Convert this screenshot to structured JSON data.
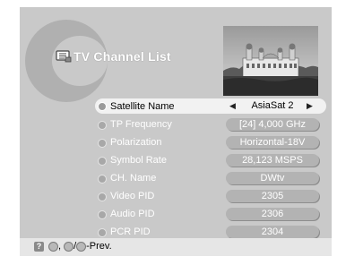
{
  "title": "TV Channel List",
  "icons": {
    "title_icon": "tv-list-icon",
    "help_icon": "question-icon",
    "footer_buttons": [
      "info-button-icon",
      "menu-button-icon",
      "exit-button-icon"
    ]
  },
  "colors": {
    "panel": "#c9c9c9",
    "big_letter": "#b0b0b0",
    "selected_row": "#f2f2f2",
    "value_pill": "#b3b3b3",
    "footer": "#e6e6e6"
  },
  "rows": [
    {
      "label": "Satellite Name",
      "value": "AsiaSat 2",
      "selected": true
    },
    {
      "label": "TP Frequency",
      "value": "[24]  4,000 GHz"
    },
    {
      "label": "Polarization",
      "value": "Horizontal-18V"
    },
    {
      "label": "Symbol Rate",
      "value": "28,123 MSPS"
    },
    {
      "label": "CH. Name",
      "value": "DWtv"
    },
    {
      "label": "Video PID",
      "value": "2305"
    },
    {
      "label": "Audio PID",
      "value": "2306"
    },
    {
      "label": "PCR PID",
      "value": "2304"
    }
  ],
  "footer": {
    "help_symbol": "?",
    "sep1": ",",
    "sep2": "/",
    "prev_label": "-Prev."
  }
}
